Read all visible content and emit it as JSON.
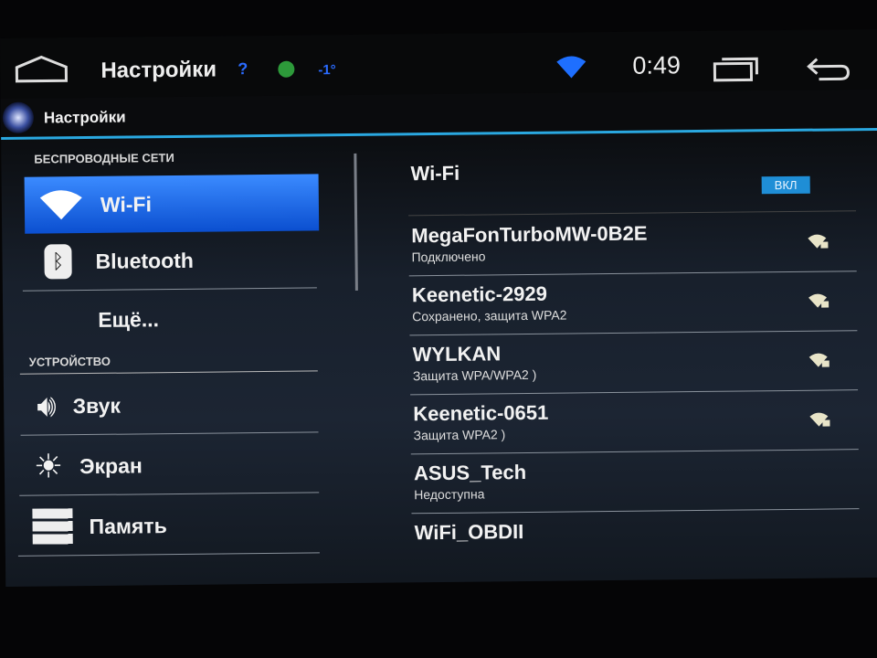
{
  "status_bar": {
    "title": "Настройки",
    "help": "?",
    "temperature": "-1°",
    "time": "0:49",
    "icons": [
      "home-icon",
      "weather-icon",
      "wifi-signal-icon",
      "recent-apps-icon",
      "back-icon"
    ]
  },
  "action_bar": {
    "title": "Настройки"
  },
  "sidebar": {
    "section_wireless": "БЕСПРОВОДНЫЕ СЕТИ",
    "section_device": "УСТРОЙСТВО",
    "items": [
      {
        "label": "Wi-Fi",
        "icon": "wifi-icon",
        "selected": true
      },
      {
        "label": "Bluetooth",
        "icon": "bluetooth-icon"
      },
      {
        "label": "Ещё..."
      },
      {
        "label": "Звук",
        "icon": "speaker-icon"
      },
      {
        "label": "Экран",
        "icon": "brightness-icon"
      },
      {
        "label": "Память",
        "icon": "storage-icon"
      }
    ]
  },
  "wifi": {
    "title": "Wi-Fi",
    "toggle": "ВКЛ",
    "networks": [
      {
        "name": "MegaFonTurboMW-0B2E",
        "status": "Подключено",
        "secured": true
      },
      {
        "name": "Keenetic-2929",
        "status": "Сохранено, защита WPA2",
        "secured": true
      },
      {
        "name": "WYLKAN",
        "status": "Защита WPA/WPA2 )",
        "secured": true
      },
      {
        "name": "Keenetic-0651",
        "status": "Защита WPA2 )",
        "secured": true
      },
      {
        "name": "ASUS_Tech",
        "status": "Недоступна"
      },
      {
        "name": "WiFi_OBDII",
        "status": ""
      }
    ]
  },
  "colors": {
    "accent": "#2aa8e0",
    "selected": "#1a5fe0",
    "status_blue": "#2a6bff"
  }
}
